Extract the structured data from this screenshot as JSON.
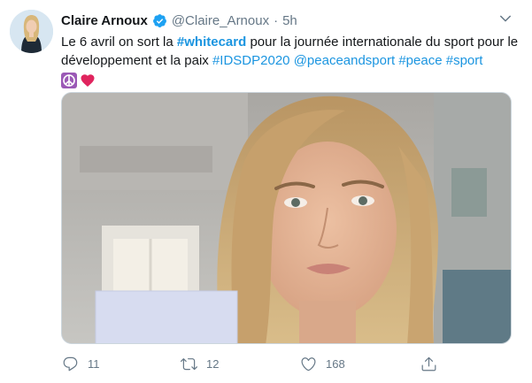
{
  "tweet": {
    "author_name": "Claire Arnoux",
    "handle": "@Claire_Arnoux",
    "separator": "·",
    "time": "5h",
    "text_parts": {
      "p1": "Le 6 avril on sort la ",
      "hashtag_whitecard": "#whitecard",
      "p2": " pour la journée internationale du sport pour le développement et la paix ",
      "hashtag_idsdp": "#IDSDP2020",
      "sp1": " ",
      "mention": "@peaceandsport",
      "sp2": " ",
      "hashtag_peace": "#peace",
      "sp3": " ",
      "hashtag_sport": "#sport"
    },
    "emojis": [
      "peace-symbol-icon",
      "red-heart-icon"
    ],
    "media": {
      "alt_description": ""
    }
  },
  "actions": {
    "reply_count": "11",
    "retweet_count": "12",
    "like_count": "168"
  },
  "colors": {
    "link": "#1b95e0",
    "secondary_text": "#657786",
    "verified": "#1da1f2",
    "border": "#ccd6dd"
  }
}
